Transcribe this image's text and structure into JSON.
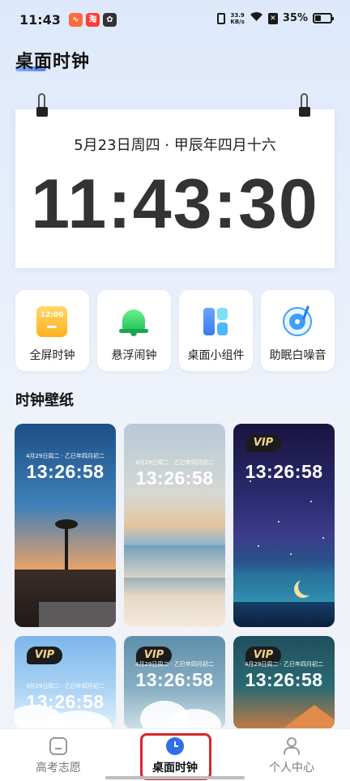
{
  "status_bar": {
    "time": "11:43",
    "app_badges": [
      "∿",
      "淘",
      "✿"
    ],
    "network_speed_value": "33.9",
    "network_speed_unit": "KB/s",
    "battery": "35%"
  },
  "page": {
    "title": "桌面时钟"
  },
  "clock": {
    "date": "5月23日周四 · 甲辰年四月十六",
    "time": "11:43:30"
  },
  "features": [
    {
      "label": "全屏时钟",
      "icon": "fullscreen-clock-icon",
      "icon_text": "12:00"
    },
    {
      "label": "悬浮闹钟",
      "icon": "bell-icon"
    },
    {
      "label": "桌面小组件",
      "icon": "widget-icon"
    },
    {
      "label": "助眠白噪音",
      "icon": "vinyl-disc-icon"
    }
  ],
  "wallpapers": {
    "title": "时钟壁纸",
    "items": [
      {
        "date": "4月29日周二 · 乙巳年四月初二",
        "time": "13:26:58",
        "vip": false
      },
      {
        "date": "4月29日周二 · 乙巳年四月初二",
        "time": "13:26:58",
        "vip": false
      },
      {
        "date": "",
        "time": "13:26:58",
        "vip": true
      },
      {
        "date": "4月29日周二 · 乙巳年四月初二",
        "time": "13:26:58",
        "vip": true
      },
      {
        "date": "4月29日周二 · 乙巳年四月初二",
        "time": "13:26:58",
        "vip": true
      },
      {
        "date": "4月29日周二 · 乙巳年四月初二",
        "time": "13:26:58",
        "vip": true
      }
    ],
    "vip_label": "VIP"
  },
  "bottom_nav": {
    "items": [
      {
        "label": "高考志愿",
        "icon": "home-icon",
        "active": false
      },
      {
        "label": "桌面时钟",
        "icon": "clock-icon",
        "active": true
      },
      {
        "label": "个人中心",
        "icon": "user-icon",
        "active": false
      }
    ]
  },
  "colors": {
    "accent": "#2f6fe8",
    "highlight_box": "#d9262b",
    "vip_gold": "#f5d48a"
  }
}
